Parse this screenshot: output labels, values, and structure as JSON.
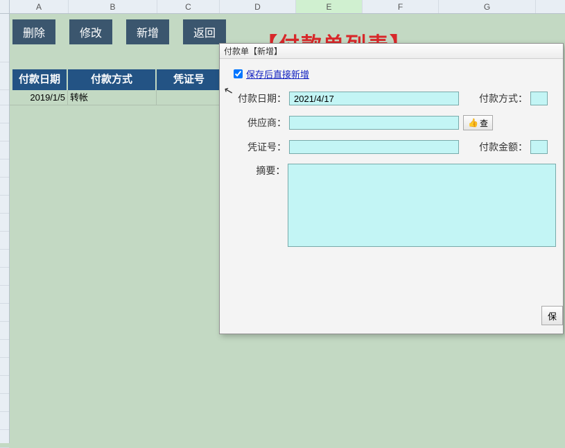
{
  "columns": [
    "A",
    "B",
    "C",
    "D",
    "E",
    "F",
    "G"
  ],
  "toolbar": {
    "delete": "删除",
    "modify": "修改",
    "add": "新增",
    "back": "返回"
  },
  "page_title": "【付款单列表】",
  "table": {
    "headers": {
      "date": "付款日期",
      "method": "付款方式",
      "voucher": "凭证号"
    },
    "rows": [
      {
        "date": "2019/1/5",
        "method": "转帐",
        "voucher": ""
      }
    ]
  },
  "dialog": {
    "title": "付款单【新增】",
    "save_after_add_label": "保存后直接新增",
    "save_after_add_checked": true,
    "form": {
      "pay_date_label": "付款日期：",
      "pay_date_value": "2021/4/17",
      "pay_method_label": "付款方式：",
      "pay_method_value": "",
      "supplier_label": "供应商：",
      "supplier_value": "",
      "lookup_label": "查",
      "voucher_label": "凭证号：",
      "voucher_value": "",
      "amount_label": "付款金额：",
      "amount_value": "",
      "memo_label": "摘要：",
      "memo_value": ""
    },
    "save_button": "保"
  }
}
